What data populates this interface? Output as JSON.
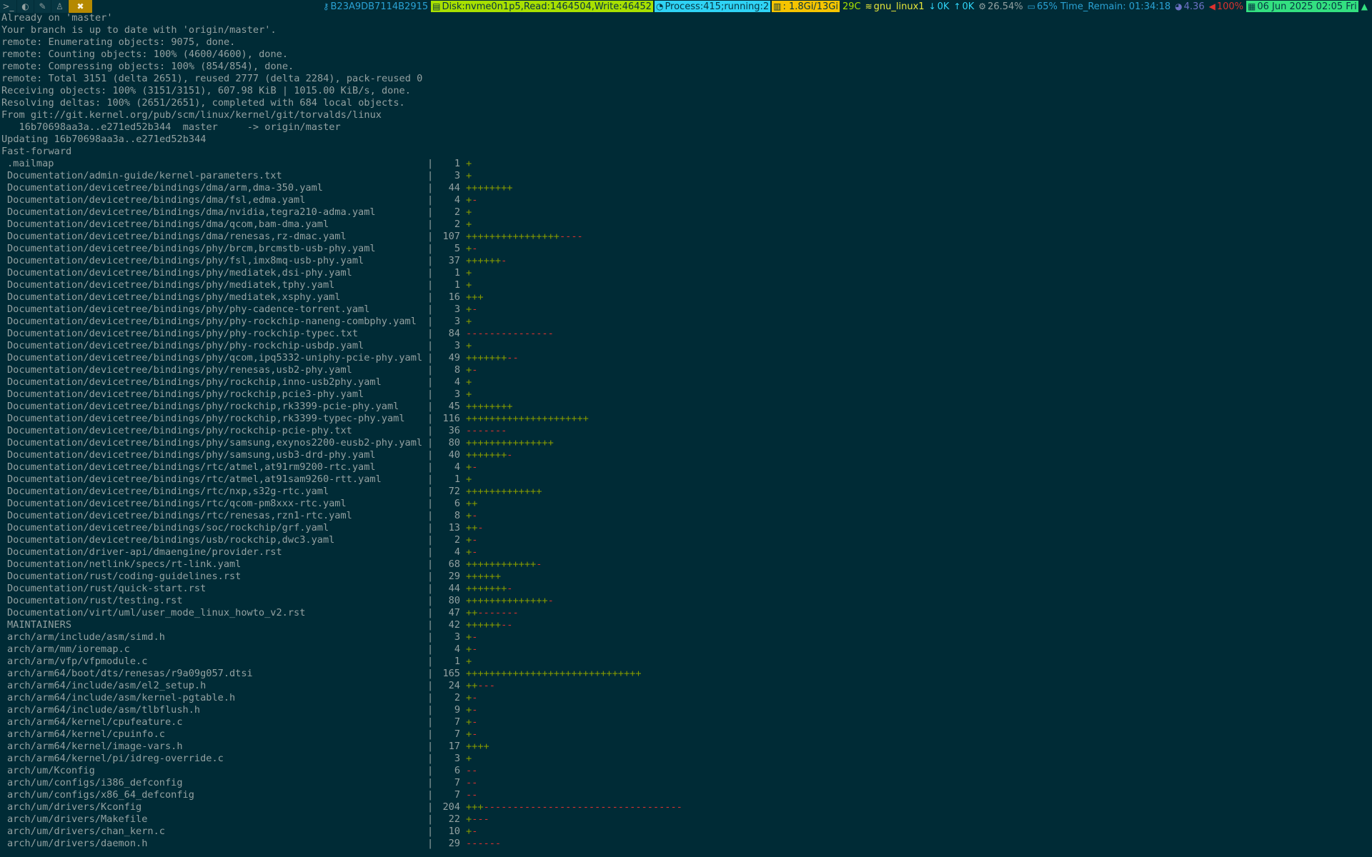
{
  "topbar": {
    "workspaces": [
      {
        "name": "terminal-workspace",
        "glyph": ">_"
      },
      {
        "name": "browser-workspace",
        "glyph": "◐"
      },
      {
        "name": "editor-workspace",
        "glyph": "✎"
      },
      {
        "name": "linux-workspace",
        "glyph": "♙"
      },
      {
        "name": "tools-workspace",
        "glyph": "✖",
        "active": true
      }
    ],
    "key_id": "B23A9DB7114B2915",
    "disk": "Disk:nvme0n1p5,Read:1464504,Write:46452",
    "process": "Process:415;running:2",
    "memory": ": 1.8Gi/13Gi",
    "temperature": "29C",
    "network": "gnu_linux1",
    "download": "0K",
    "upload": "0K",
    "cpu": "26.54%",
    "battery": "65% Time_Remain: 01:34:18",
    "load": "4.36",
    "volume": "100%",
    "datetime": "06 Jun 2025 02:05 Fri"
  },
  "colors": {
    "background": "#002b36",
    "text": "#93a1a1",
    "plus": "#859900",
    "minus": "#dc322f"
  },
  "header_lines": [
    "Already on 'master'",
    "Your branch is up to date with 'origin/master'.",
    "remote: Enumerating objects: 9075, done.",
    "remote: Counting objects: 100% (4600/4600), done.",
    "remote: Compressing objects: 100% (854/854), done.",
    "remote: Total 3151 (delta 2651), reused 2777 (delta 2284), pack-reused 0",
    "Receiving objects: 100% (3151/3151), 607.98 KiB | 1015.00 KiB/s, done.",
    "Resolving deltas: 100% (2651/2651), completed with 684 local objects.",
    "From git://git.kernel.org/pub/scm/linux/kernel/git/torvalds/linux",
    "   16b70698aa3a..e271ed52b344  master     -> origin/master",
    "Updating 16b70698aa3a..e271ed52b344",
    "Fast-forward"
  ],
  "diffstat": [
    {
      "path": ".mailmap",
      "count": "1",
      "plus": "+",
      "minus": ""
    },
    {
      "path": "Documentation/admin-guide/kernel-parameters.txt",
      "count": "3",
      "plus": "+",
      "minus": ""
    },
    {
      "path": "Documentation/devicetree/bindings/dma/arm,dma-350.yaml",
      "count": "44",
      "plus": "++++++++",
      "minus": ""
    },
    {
      "path": "Documentation/devicetree/bindings/dma/fsl,edma.yaml",
      "count": "4",
      "plus": "+",
      "minus": "-"
    },
    {
      "path": "Documentation/devicetree/bindings/dma/nvidia,tegra210-adma.yaml",
      "count": "2",
      "plus": "+",
      "minus": ""
    },
    {
      "path": "Documentation/devicetree/bindings/dma/qcom,bam-dma.yaml",
      "count": "2",
      "plus": "+",
      "minus": ""
    },
    {
      "path": "Documentation/devicetree/bindings/dma/renesas,rz-dmac.yaml",
      "count": "107",
      "plus": "++++++++++++++++",
      "minus": "----"
    },
    {
      "path": "Documentation/devicetree/bindings/phy/brcm,brcmstb-usb-phy.yaml",
      "count": "5",
      "plus": "+",
      "minus": "-"
    },
    {
      "path": "Documentation/devicetree/bindings/phy/fsl,imx8mq-usb-phy.yaml",
      "count": "37",
      "plus": "++++++",
      "minus": "-"
    },
    {
      "path": "Documentation/devicetree/bindings/phy/mediatek,dsi-phy.yaml",
      "count": "1",
      "plus": "+",
      "minus": ""
    },
    {
      "path": "Documentation/devicetree/bindings/phy/mediatek,tphy.yaml",
      "count": "1",
      "plus": "+",
      "minus": ""
    },
    {
      "path": "Documentation/devicetree/bindings/phy/mediatek,xsphy.yaml",
      "count": "16",
      "plus": "+++",
      "minus": ""
    },
    {
      "path": "Documentation/devicetree/bindings/phy/phy-cadence-torrent.yaml",
      "count": "3",
      "plus": "+",
      "minus": "-"
    },
    {
      "path": "Documentation/devicetree/bindings/phy/phy-rockchip-naneng-combphy.yaml",
      "count": "3",
      "plus": "+",
      "minus": ""
    },
    {
      "path": "Documentation/devicetree/bindings/phy/phy-rockchip-typec.txt",
      "count": "84",
      "plus": "",
      "minus": "---------------"
    },
    {
      "path": "Documentation/devicetree/bindings/phy/phy-rockchip-usbdp.yaml",
      "count": "3",
      "plus": "+",
      "minus": ""
    },
    {
      "path": "Documentation/devicetree/bindings/phy/qcom,ipq5332-uniphy-pcie-phy.yaml",
      "count": "49",
      "plus": "+++++++",
      "minus": "--"
    },
    {
      "path": "Documentation/devicetree/bindings/phy/renesas,usb2-phy.yaml",
      "count": "8",
      "plus": "+",
      "minus": "-"
    },
    {
      "path": "Documentation/devicetree/bindings/phy/rockchip,inno-usb2phy.yaml",
      "count": "4",
      "plus": "+",
      "minus": ""
    },
    {
      "path": "Documentation/devicetree/bindings/phy/rockchip,pcie3-phy.yaml",
      "count": "3",
      "plus": "+",
      "minus": ""
    },
    {
      "path": "Documentation/devicetree/bindings/phy/rockchip,rk3399-pcie-phy.yaml",
      "count": "45",
      "plus": "++++++++",
      "minus": ""
    },
    {
      "path": "Documentation/devicetree/bindings/phy/rockchip,rk3399-typec-phy.yaml",
      "count": "116",
      "plus": "+++++++++++++++++++++",
      "minus": ""
    },
    {
      "path": "Documentation/devicetree/bindings/phy/rockchip-pcie-phy.txt",
      "count": "36",
      "plus": "",
      "minus": "-------"
    },
    {
      "path": "Documentation/devicetree/bindings/phy/samsung,exynos2200-eusb2-phy.yaml",
      "count": "80",
      "plus": "+++++++++++++++",
      "minus": ""
    },
    {
      "path": "Documentation/devicetree/bindings/phy/samsung,usb3-drd-phy.yaml",
      "count": "40",
      "plus": "+++++++",
      "minus": "-"
    },
    {
      "path": "Documentation/devicetree/bindings/rtc/atmel,at91rm9200-rtc.yaml",
      "count": "4",
      "plus": "+",
      "minus": "-"
    },
    {
      "path": "Documentation/devicetree/bindings/rtc/atmel,at91sam9260-rtt.yaml",
      "count": "1",
      "plus": "+",
      "minus": ""
    },
    {
      "path": "Documentation/devicetree/bindings/rtc/nxp,s32g-rtc.yaml",
      "count": "72",
      "plus": "+++++++++++++",
      "minus": ""
    },
    {
      "path": "Documentation/devicetree/bindings/rtc/qcom-pm8xxx-rtc.yaml",
      "count": "6",
      "plus": "++",
      "minus": ""
    },
    {
      "path": "Documentation/devicetree/bindings/rtc/renesas,rzn1-rtc.yaml",
      "count": "8",
      "plus": "+",
      "minus": "-"
    },
    {
      "path": "Documentation/devicetree/bindings/soc/rockchip/grf.yaml",
      "count": "13",
      "plus": "++",
      "minus": "-"
    },
    {
      "path": "Documentation/devicetree/bindings/usb/rockchip,dwc3.yaml",
      "count": "2",
      "plus": "+",
      "minus": "-"
    },
    {
      "path": "Documentation/driver-api/dmaengine/provider.rst",
      "count": "4",
      "plus": "+",
      "minus": "-"
    },
    {
      "path": "Documentation/netlink/specs/rt-link.yaml",
      "count": "68",
      "plus": "++++++++++++",
      "minus": "-"
    },
    {
      "path": "Documentation/rust/coding-guidelines.rst",
      "count": "29",
      "plus": "++++++",
      "minus": ""
    },
    {
      "path": "Documentation/rust/quick-start.rst",
      "count": "44",
      "plus": "+++++++",
      "minus": "-"
    },
    {
      "path": "Documentation/rust/testing.rst",
      "count": "80",
      "plus": "++++++++++++++",
      "minus": "-"
    },
    {
      "path": "Documentation/virt/uml/user_mode_linux_howto_v2.rst",
      "count": "47",
      "plus": "++",
      "minus": "-------"
    },
    {
      "path": "MAINTAINERS",
      "count": "42",
      "plus": "++++++",
      "minus": "--"
    },
    {
      "path": "arch/arm/include/asm/simd.h",
      "count": "3",
      "plus": "+",
      "minus": "-"
    },
    {
      "path": "arch/arm/mm/ioremap.c",
      "count": "4",
      "plus": "+",
      "minus": "-"
    },
    {
      "path": "arch/arm/vfp/vfpmodule.c",
      "count": "1",
      "plus": "+",
      "minus": ""
    },
    {
      "path": "arch/arm64/boot/dts/renesas/r9a09g057.dtsi",
      "count": "165",
      "plus": "++++++++++++++++++++++++++++++",
      "minus": ""
    },
    {
      "path": "arch/arm64/include/asm/el2_setup.h",
      "count": "24",
      "plus": "++",
      "minus": "---"
    },
    {
      "path": "arch/arm64/include/asm/kernel-pgtable.h",
      "count": "2",
      "plus": "+",
      "minus": "-"
    },
    {
      "path": "arch/arm64/include/asm/tlbflush.h",
      "count": "9",
      "plus": "+",
      "minus": "-"
    },
    {
      "path": "arch/arm64/kernel/cpufeature.c",
      "count": "7",
      "plus": "+",
      "minus": "-"
    },
    {
      "path": "arch/arm64/kernel/cpuinfo.c",
      "count": "7",
      "plus": "+",
      "minus": "-"
    },
    {
      "path": "arch/arm64/kernel/image-vars.h",
      "count": "17",
      "plus": "++++",
      "minus": ""
    },
    {
      "path": "arch/arm64/kernel/pi/idreg-override.c",
      "count": "3",
      "plus": "+",
      "minus": ""
    },
    {
      "path": "arch/um/Kconfig",
      "count": "6",
      "plus": "",
      "minus": "--"
    },
    {
      "path": "arch/um/configs/i386_defconfig",
      "count": "7",
      "plus": "",
      "minus": "--"
    },
    {
      "path": "arch/um/configs/x86_64_defconfig",
      "count": "7",
      "plus": "",
      "minus": "--"
    },
    {
      "path": "arch/um/drivers/Kconfig",
      "count": "204",
      "plus": "+++",
      "minus": "----------------------------------"
    },
    {
      "path": "arch/um/drivers/Makefile",
      "count": "22",
      "plus": "+",
      "minus": "---"
    },
    {
      "path": "arch/um/drivers/chan_kern.c",
      "count": "10",
      "plus": "+",
      "minus": "-"
    },
    {
      "path": "arch/um/drivers/daemon.h",
      "count": "29",
      "plus": "",
      "minus": "------"
    }
  ]
}
